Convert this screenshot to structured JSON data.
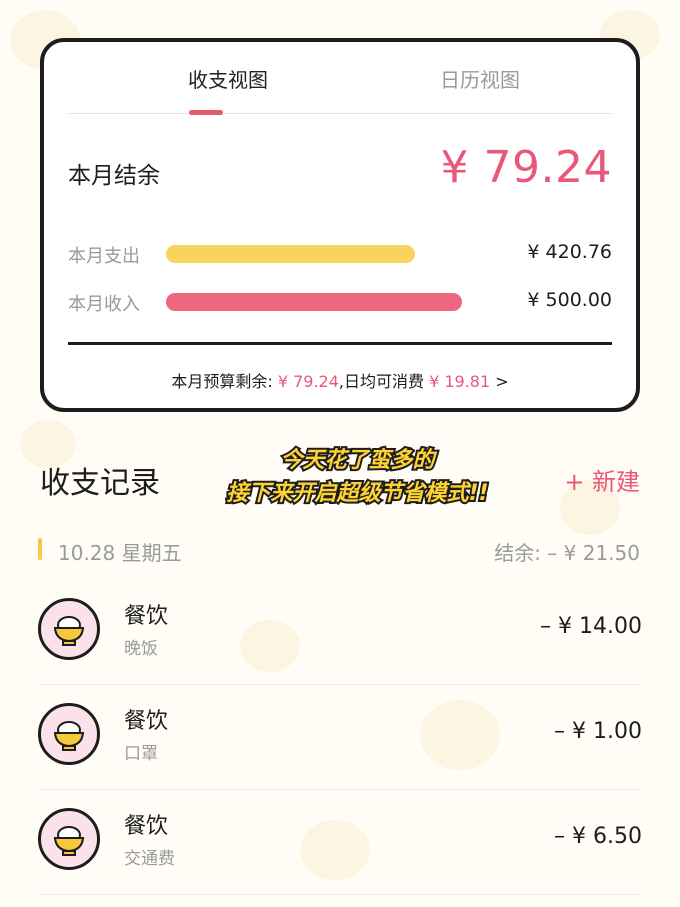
{
  "tabs": [
    "收支视图",
    "日历视图"
  ],
  "summary": {
    "balance_label": "本月结余",
    "balance_value": "¥ 79.24",
    "expense_label": "本月支出",
    "expense_value": "¥ 420.76",
    "expense_fraction": 0.84,
    "income_label": "本月收入",
    "income_value": "¥ 500.00",
    "income_fraction": 1.0,
    "budget_prefix": "本月预算剩余:",
    "budget_remaining": "¥ 79.24",
    "budget_mid": ",日均可消费",
    "daily_amount": "¥ 19.81",
    "budget_arrow": ">"
  },
  "records_section": {
    "title": "收支记录",
    "new_button": "+ 新建",
    "overlay_line1": "今天花了蛮多的",
    "overlay_line2": "接下来开启超级节省模式!!"
  },
  "day": {
    "label": "10.28 星期五",
    "balance": "结余: – ¥ 21.50"
  },
  "records": [
    {
      "category": "餐饮",
      "note": "晚饭",
      "amount": "– ¥ 14.00",
      "icon": "rice-bowl-icon"
    },
    {
      "category": "餐饮",
      "note": "口罩",
      "amount": "– ¥ 1.00",
      "icon": "rice-bowl-icon"
    },
    {
      "category": "餐饮",
      "note": "交通费",
      "amount": "– ¥ 6.50",
      "icon": "rice-bowl-icon"
    }
  ],
  "colors": {
    "accent_pink": "#e9587a",
    "expense_bar": "#f8d45c",
    "income_bar": "#ee6680",
    "indicator_yellow": "#f5c84b"
  }
}
